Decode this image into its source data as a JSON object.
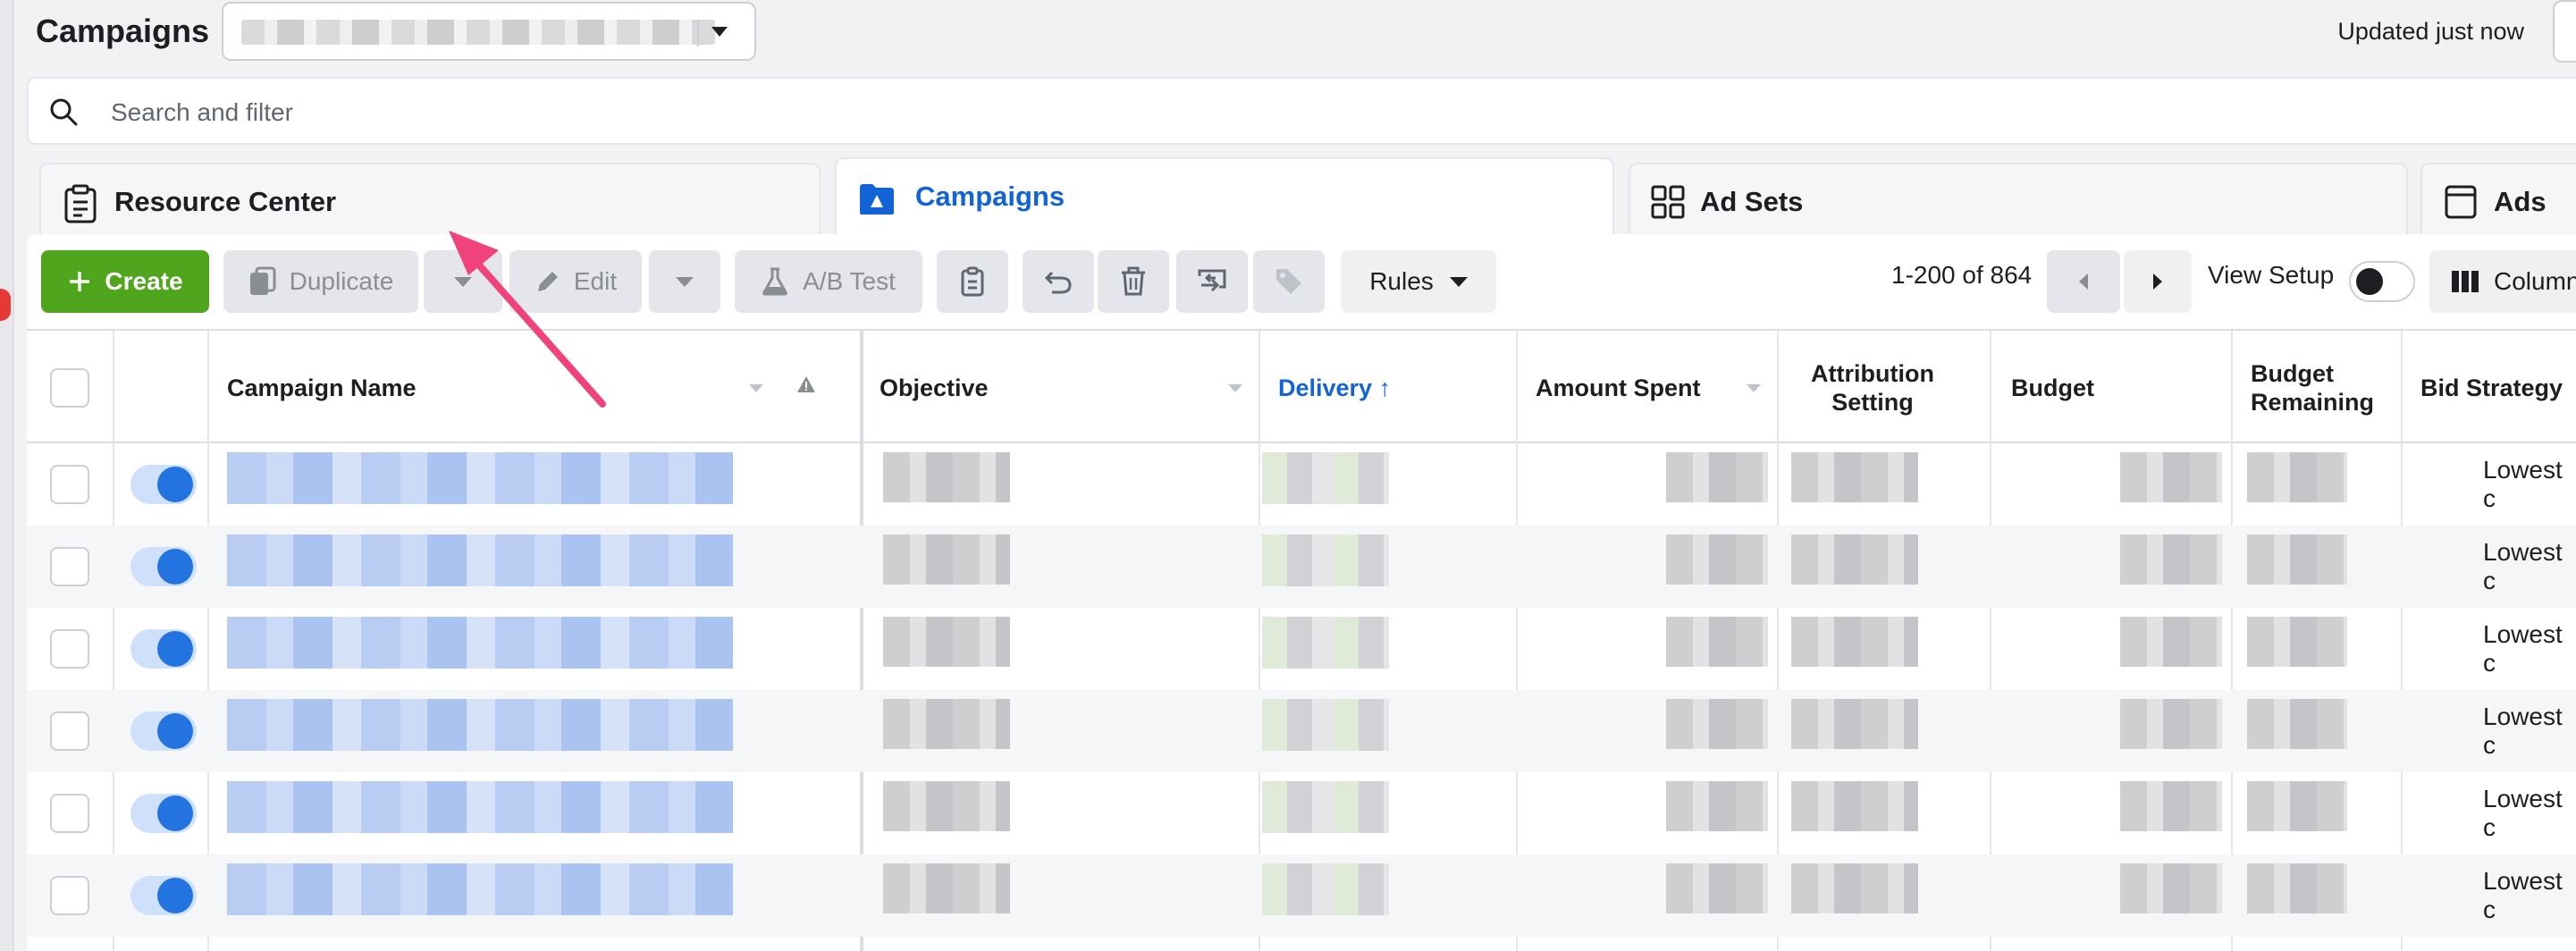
{
  "header": {
    "title": "Campaigns",
    "updated": "Updated just now"
  },
  "search": {
    "placeholder": "Search and filter"
  },
  "tabs": [
    {
      "label": "Resource Center",
      "icon": "clipboard-icon"
    },
    {
      "label": "Campaigns",
      "icon": "folder-icon",
      "active": true
    },
    {
      "label": "Ad Sets",
      "icon": "grid-icon"
    },
    {
      "label": "Ads",
      "icon": "ad-icon"
    }
  ],
  "toolbar": {
    "create": "Create",
    "duplicate": "Duplicate",
    "edit": "Edit",
    "ab_test": "A/B Test",
    "rules": "Rules",
    "pagination": "1-200 of 864",
    "view_setup": "View Setup",
    "columns": "Columns"
  },
  "table": {
    "columns": [
      "Campaign Name",
      "Objective",
      "Delivery",
      "Amount Spent",
      "Attribution Setting",
      "Budget",
      "Budget Remaining",
      "Bid Strategy"
    ],
    "delivery_sort": "↑",
    "rows": [
      {
        "bid_strategy": "Lowest c"
      },
      {
        "bid_strategy": "Lowest c"
      },
      {
        "bid_strategy": "Lowest c"
      },
      {
        "bid_strategy": "Lowest c"
      },
      {
        "bid_strategy": "Lowest c"
      },
      {
        "bid_strategy": "Lowest c"
      }
    ]
  },
  "colors": {
    "accent_blue": "#1264d6",
    "create_green": "#4fa51b",
    "annotation_arrow": "#f0437c"
  }
}
